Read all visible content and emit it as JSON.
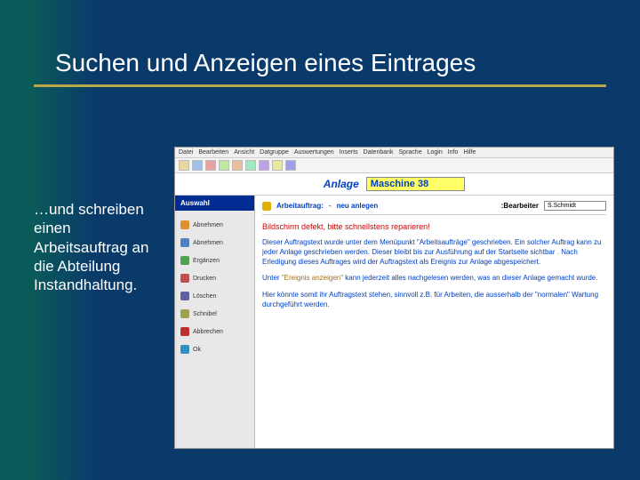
{
  "slide": {
    "title": "Suchen und Anzeigen eines Eintrages",
    "caption": "…und schreiben einen Arbeitsauftrag an die Abteilung Instandhaltung."
  },
  "app": {
    "menu": [
      "Datei",
      "Bearbeiten",
      "Ansicht",
      "Datgruppe",
      "Auswertungen",
      "Inserts",
      "Datenbank",
      "Sprache",
      "Login",
      "Info",
      "Hilfe"
    ],
    "header_label": "Anlage",
    "machine_value": "Maschine 38",
    "sidebar": {
      "title": "Auswahl",
      "items": [
        {
          "label": "Abnehmen",
          "color": "#e09030"
        },
        {
          "label": "Abnehmen",
          "color": "#5080c0"
        },
        {
          "label": "Ergänzen",
          "color": "#50a050"
        },
        {
          "label": "Drucken",
          "color": "#c05050"
        },
        {
          "label": "Löschen",
          "color": "#6060a0"
        },
        {
          "label": "Schnibel",
          "color": "#a0a050"
        },
        {
          "label": "Abbrechen",
          "color": "#c03030"
        },
        {
          "label": "Ok",
          "color": "#3090c0"
        }
      ]
    },
    "order": {
      "label": "Arbeitauftrag:",
      "dash": "-",
      "new_link": "neu anlegen",
      "bearbeiter_label": ":Bearbeiter",
      "bearbeiter_value": "S.Schmidt"
    },
    "alert_text": "Bildschirm defekt, bitte schnellstens reparieren!",
    "para1": "Dieser Auftragstext wurde unter dem Menüpunkt \"Arbeitsaufträge\" geschrieben. Ein solcher Auftrag kann zu jeder Anlage geschrieben werden. Dieser bleibt bis zur Ausführung auf der Startseite sichtbar . Nach Erledigung dieses Auftrages wird der Auftragstext als Ereignis zur Anlage abgespeichert.",
    "para2_pre": "Unter ",
    "para2_em": "\"Ereignis anzeigen\"",
    "para2_post": " kann jederzeit alles nachgelesen werden, was an dieser Anlage gemacht wurde.",
    "para3": "Hier könnte somit ihr Auftragstext stehen, sinnvoll z.B. für Arbeiten, die ausserhalb der \"normalen\" Wartung durchgeführt werden."
  }
}
